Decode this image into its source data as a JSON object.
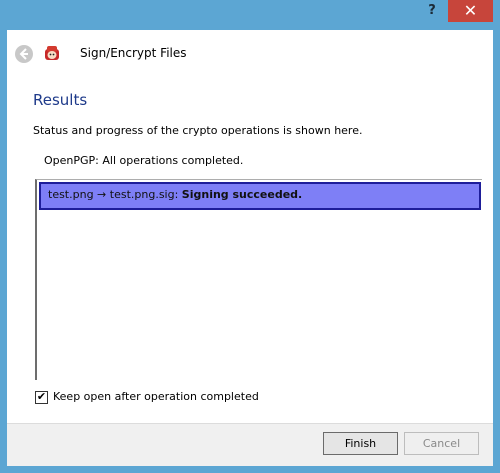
{
  "titlebar": {
    "help_label": "?",
    "close_label": "✕"
  },
  "header": {
    "title": "Sign/Encrypt Files",
    "back_icon": "back-arrow-icon",
    "app_icon": "kleopatra-icon"
  },
  "page": {
    "title": "Results",
    "description": "Status and progress of the crypto operations is shown here.",
    "status": "OpenPGP: All operations completed."
  },
  "results": [
    {
      "prefix": "test.png → test.png.sig: ",
      "status": "Signing succeeded."
    }
  ],
  "options": {
    "keep_open_label": "Keep open after operation completed",
    "keep_open_checked": true,
    "check_mark": "✔"
  },
  "footer": {
    "finish_label": "Finish",
    "cancel_label": "Cancel"
  },
  "colors": {
    "window_frame": "#5ca6d3",
    "close_button": "#c7453b",
    "selected_row": "#7e7ff6",
    "title_blue": "#1e3a8a"
  }
}
